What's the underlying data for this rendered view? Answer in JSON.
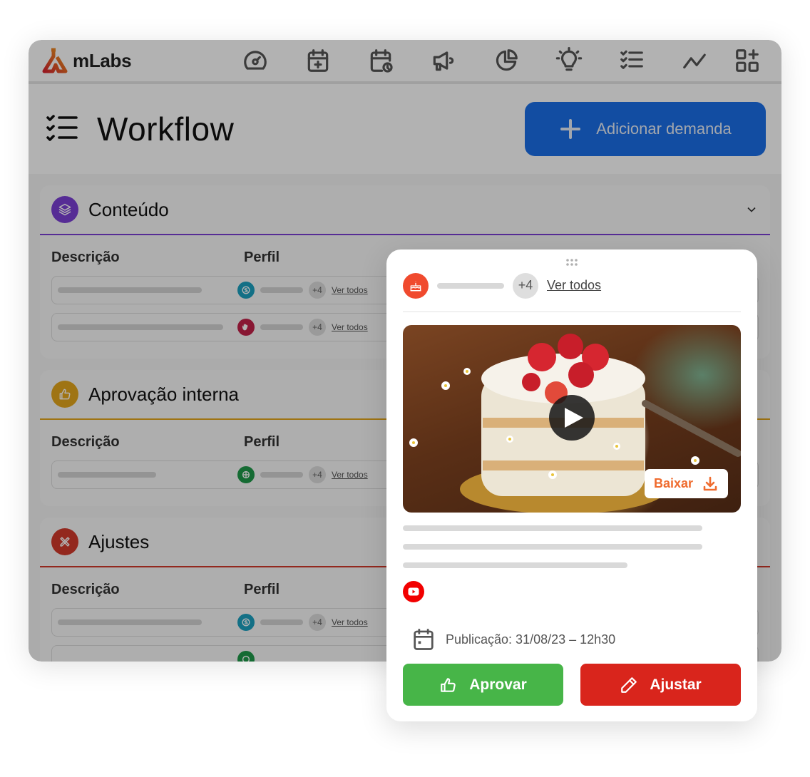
{
  "app": {
    "logo_text": "mLabs",
    "nav": [
      {
        "icon": "dashboard-gauge-icon"
      },
      {
        "icon": "calendar-add-icon"
      },
      {
        "icon": "calendar-clock-icon"
      },
      {
        "icon": "megaphone-icon"
      },
      {
        "icon": "pie-chart-icon"
      },
      {
        "icon": "lightbulb-icon"
      },
      {
        "icon": "checklist-icon"
      },
      {
        "icon": "line-chart-icon"
      },
      {
        "icon": "apps-grid-add-icon"
      }
    ]
  },
  "header": {
    "title": "Workflow",
    "add_button_label": "Adicionar demanda"
  },
  "sections": [
    {
      "title": "Conteúdo",
      "color": "#7b3fd6",
      "icon": "layers-icon",
      "col_desc": "Descrição",
      "col_profile": "Perfil",
      "rows": [
        {
          "profile_color": "#1ca1c1",
          "profile_icon": "skype-icon",
          "more": "+4",
          "link": "Ver todos"
        },
        {
          "profile_color": "#c3214a",
          "profile_icon": "hand-icon",
          "more": "+4",
          "link": "Ver todos"
        }
      ]
    },
    {
      "title": "Aprovação interna",
      "color": "#e4a61c",
      "icon": "thumbs-up-icon",
      "col_desc": "Descrição",
      "col_profile": "Perfil",
      "rows": [
        {
          "profile_color": "#1f9a4a",
          "profile_icon": "flower-icon",
          "more": "+4",
          "link": "Ver todos"
        }
      ]
    },
    {
      "title": "Ajustes",
      "color": "#d33a2c",
      "icon": "tools-icon",
      "col_desc": "Descrição",
      "col_profile": "Perfil",
      "rows": [
        {
          "profile_color": "#1ca1c1",
          "profile_icon": "skype-icon",
          "more": "+4",
          "link": "Ver todos"
        },
        {
          "profile_color": "#1f9a4a",
          "profile_icon": "flower-icon",
          "more": "",
          "link": ""
        }
      ]
    }
  ],
  "card": {
    "profile_more": "+4",
    "profile_link": "Ver todos",
    "media": {
      "type": "video",
      "download_label": "Baixar"
    },
    "network": "youtube",
    "publication": "Publicação: 31/08/23 – 12h30",
    "approve_label": "Aprovar",
    "adjust_label": "Ajustar",
    "colors": {
      "approve": "#47b548",
      "adjust": "#d9251c",
      "download": "#ef6b2e"
    }
  }
}
